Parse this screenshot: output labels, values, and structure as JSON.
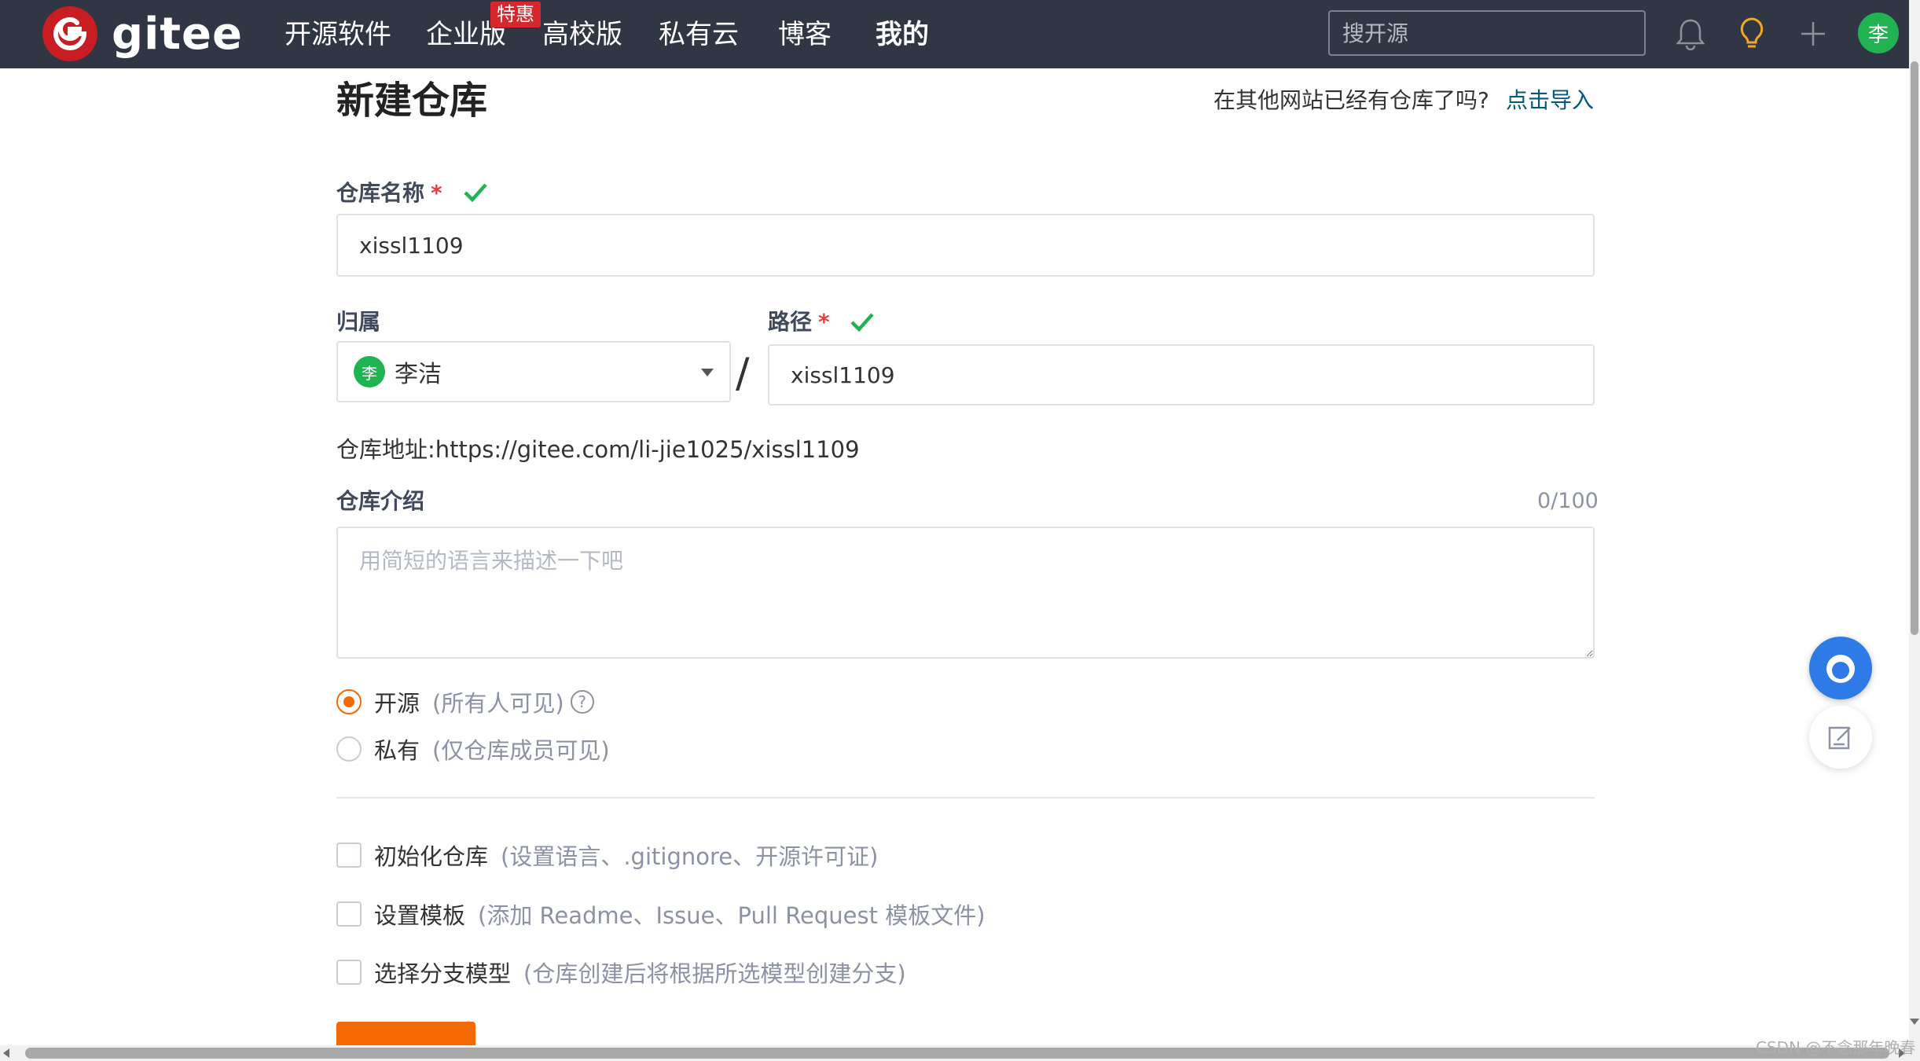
{
  "nav": {
    "logo_text": "gitee",
    "items": [
      "开源软件",
      "企业版",
      "高校版",
      "私有云",
      "博客",
      "我的"
    ],
    "badge": "特惠",
    "search_placeholder": "搜开源",
    "avatar_initial": "李"
  },
  "page": {
    "title": "新建仓库",
    "import_prompt": "在其他网站已经有仓库了吗?",
    "import_link": "点击导入"
  },
  "form": {
    "repo_name_label": "仓库名称",
    "required_mark": "*",
    "repo_name_value": "xissl1109",
    "owner_label": "归属",
    "owner_initial": "李",
    "owner_name": "李洁",
    "separator": "/",
    "path_label": "路径",
    "path_value": "xissl1109",
    "repo_url_label": "仓库地址:",
    "repo_url": "https://gitee.com/li-jie1025/xissl1109",
    "intro_label": "仓库介绍",
    "intro_counter": "0/100",
    "intro_placeholder": "用简短的语言来描述一下吧",
    "visibility": [
      {
        "label": "开源",
        "hint": "(所有人可见)",
        "selected": true
      },
      {
        "label": "私有",
        "hint": "(仅仓库成员可见)",
        "selected": false
      }
    ],
    "options": [
      {
        "label": "初始化仓库",
        "hint": "(设置语言、.gitignore、开源许可证)",
        "checked": false
      },
      {
        "label": "设置模板",
        "hint": "(添加 Readme、Issue、Pull Request 模板文件)",
        "checked": false
      },
      {
        "label": "选择分支模型",
        "hint": "(仓库创建后将根据所选模型创建分支)",
        "checked": false
      }
    ]
  },
  "watermark": "CSDN @不念那年晚春",
  "colors": {
    "nav_bg": "#303643",
    "accent_orange": "#f56a00",
    "link_blue": "#005980",
    "check_green": "#21b352",
    "logo_red": "#c71d23"
  }
}
